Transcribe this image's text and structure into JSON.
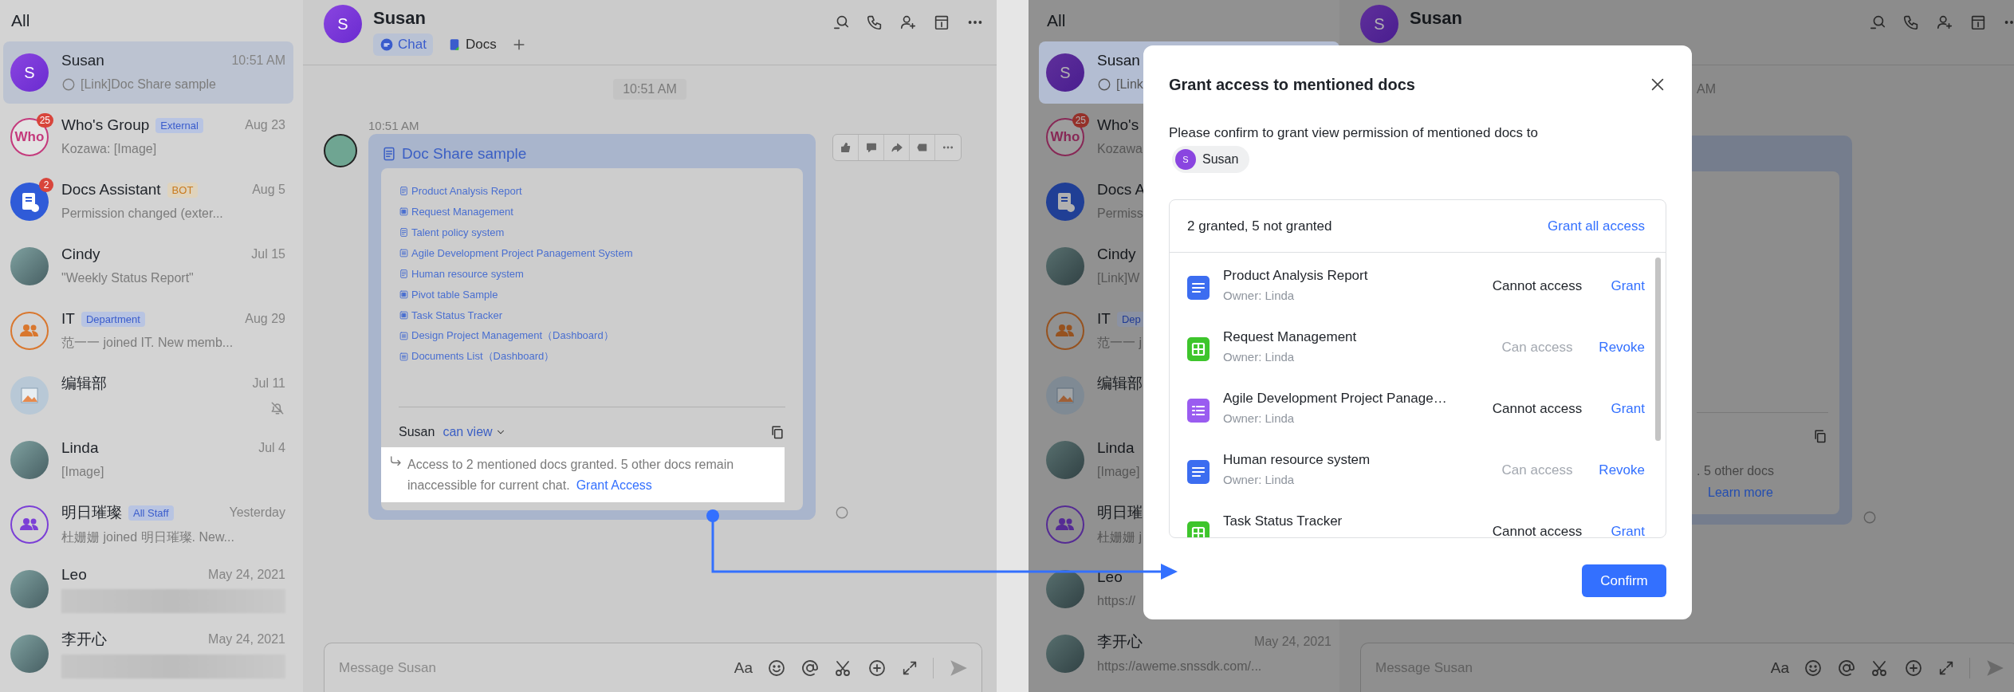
{
  "left_panel": {
    "chat_list": {
      "title": "All",
      "items": [
        {
          "name": "Susan",
          "time": "10:51 AM",
          "preview": "[Link]Doc Share sample",
          "selected": true,
          "receipt": true,
          "avatar": {
            "kind": "letter",
            "text": "S"
          }
        },
        {
          "name": "Who's Group",
          "badge": {
            "kind": "tag",
            "text": "External"
          },
          "time": "Aug 23",
          "preview": "Kozawa: [Image]",
          "selected": false,
          "unread": "25",
          "avatar": {
            "kind": "ring-text",
            "text": "Who"
          }
        },
        {
          "name": "Docs Assistant",
          "badge": {
            "kind": "bot",
            "text": "BOT"
          },
          "time": "Aug 5",
          "preview": "Permission changed (exter...",
          "selected": false,
          "unread": "2",
          "avatar": {
            "kind": "bot"
          }
        },
        {
          "name": "Cindy",
          "time": "Jul 15",
          "preview": "\"Weekly Status Report\"",
          "selected": false,
          "avatar": {
            "kind": "photo"
          }
        },
        {
          "name": "IT",
          "badge": {
            "kind": "tag",
            "text": "Department"
          },
          "time": "Aug 29",
          "preview": "范一一 joined IT. New memb...",
          "selected": false,
          "avatar": {
            "kind": "group",
            "color": "#d9772e"
          }
        },
        {
          "name": "编辑部",
          "time": "Jul 11",
          "selected": false,
          "muted": true,
          "avatar": {
            "kind": "image"
          }
        },
        {
          "name": "Linda",
          "time": "Jul 4",
          "preview": "[Image]",
          "selected": false,
          "avatar": {
            "kind": "photo"
          }
        },
        {
          "name": "明日璀璨",
          "badge": {
            "kind": "tag",
            "text": "All Staff"
          },
          "time": "Yesterday",
          "preview": "杜姗姗 joined 明日璀璨. New...",
          "selected": false,
          "avatar": {
            "kind": "group",
            "color": "#7b3fd6"
          }
        },
        {
          "name": "Leo",
          "time": "May 24, 2021",
          "selected": false,
          "redacted": true,
          "avatar": {
            "kind": "photo"
          }
        },
        {
          "name": "李开心",
          "time": "May 24, 2021",
          "selected": false,
          "redacted": true,
          "avatar": {
            "kind": "photo"
          }
        }
      ]
    },
    "chat": {
      "avatar_text": "S",
      "title": "Susan",
      "tabs": [
        {
          "label": "Chat",
          "kind": "chat",
          "selected": true
        },
        {
          "label": "Docs",
          "kind": "docs",
          "selected": false
        }
      ],
      "time_divider": "10:51 AM",
      "message": {
        "time": "10:51 AM",
        "card_title": "Doc Share sample",
        "docs": [
          {
            "title": "Product Analysis Report",
            "kind": "doc"
          },
          {
            "title": "Request Management",
            "kind": "sheet"
          },
          {
            "title": "Talent policy system",
            "kind": "doc"
          },
          {
            "title": "Agile Development Project Panagement System",
            "kind": "list"
          },
          {
            "title": "Human resource system",
            "kind": "doc"
          },
          {
            "title": "Pivot table Sample",
            "kind": "sheet"
          },
          {
            "title": "Task Status Tracker",
            "kind": "sheet"
          },
          {
            "title": "Design Project Management（Dashboard）",
            "kind": "list"
          },
          {
            "title": "Documents List（Dashboard）",
            "kind": "list"
          }
        ],
        "share_user": "Susan",
        "permission": "can view",
        "notice": {
          "text": "Access to 2 mentioned docs granted. 5 other docs remain inaccessible for current chat.",
          "link": "Grant Access"
        }
      },
      "composer": {
        "placeholder": "Message Susan",
        "format_label": "Aa"
      }
    }
  },
  "right_panel": {
    "chat_list": {
      "title": "All",
      "items": [
        {
          "name": "Susan",
          "preview": "[Link",
          "selected": true,
          "receipt": true,
          "avatar": {
            "kind": "letter",
            "text": "S"
          }
        },
        {
          "name": "Who's",
          "preview": "Kozawa",
          "selected": false,
          "unread": "25",
          "avatar": {
            "kind": "ring-text",
            "text": "Who"
          }
        },
        {
          "name": "Docs A",
          "preview": "Permiss",
          "selected": false,
          "avatar": {
            "kind": "bot"
          }
        },
        {
          "name": "Cindy",
          "preview": "[Link]W",
          "selected": false,
          "avatar": {
            "kind": "photo"
          }
        },
        {
          "name": "IT",
          "badge": {
            "kind": "tag",
            "text": "Dep"
          },
          "preview": "范一一 j",
          "selected": false,
          "avatar": {
            "kind": "group",
            "color": "#96521f"
          }
        },
        {
          "name": "编辑部",
          "selected": false,
          "avatar": {
            "kind": "image"
          }
        },
        {
          "name": "Linda",
          "preview": "[Image]",
          "selected": false,
          "avatar": {
            "kind": "photo"
          }
        },
        {
          "name": "明日璀",
          "preview": "杜姗姗 j",
          "selected": false,
          "avatar": {
            "kind": "group",
            "color": "#552b94"
          }
        },
        {
          "name": "Leo",
          "preview": "https://",
          "selected": false,
          "avatar": {
            "kind": "photo"
          }
        },
        {
          "name": "李开心",
          "time": "May 24, 2021",
          "preview": "https://aweme.snssdk.com/...",
          "selected": false,
          "avatar": {
            "kind": "photo"
          }
        }
      ]
    },
    "chat": {
      "avatar_text": "S",
      "title": "Susan",
      "time_fragment": "AM",
      "notice_fragment": ". 5 other docs",
      "notice_link": "Learn more",
      "composer": {
        "placeholder": "Message Susan",
        "format_label": "Aa"
      }
    }
  },
  "dialog": {
    "title": "Grant access to mentioned docs",
    "description": "Please confirm to grant view permission of mentioned docs to",
    "recipient": {
      "avatar_text": "S",
      "name": "Susan"
    },
    "summary": "2 granted, 5 not granted",
    "grant_all": "Grant all access",
    "docs": [
      {
        "kind": "doc",
        "title": "Product Analysis Report",
        "owner": "Owner: Linda",
        "granted": false,
        "status": "Cannot access",
        "action": "Grant"
      },
      {
        "kind": "sheet",
        "title": "Request Management",
        "owner": "Owner: Linda",
        "granted": true,
        "status": "Can access",
        "action": "Revoke"
      },
      {
        "kind": "list",
        "title": "Agile Development Project Panage…",
        "owner": "Owner: Linda",
        "granted": false,
        "status": "Cannot access",
        "action": "Grant"
      },
      {
        "kind": "doc",
        "title": "Human resource system",
        "owner": "Owner: Linda",
        "granted": true,
        "status": "Can access",
        "action": "Revoke"
      },
      {
        "kind": "sheet",
        "title": "Task Status Tracker",
        "granted": false,
        "status": "Cannot access",
        "action": "Grant"
      }
    ],
    "confirm": "Confirm"
  }
}
